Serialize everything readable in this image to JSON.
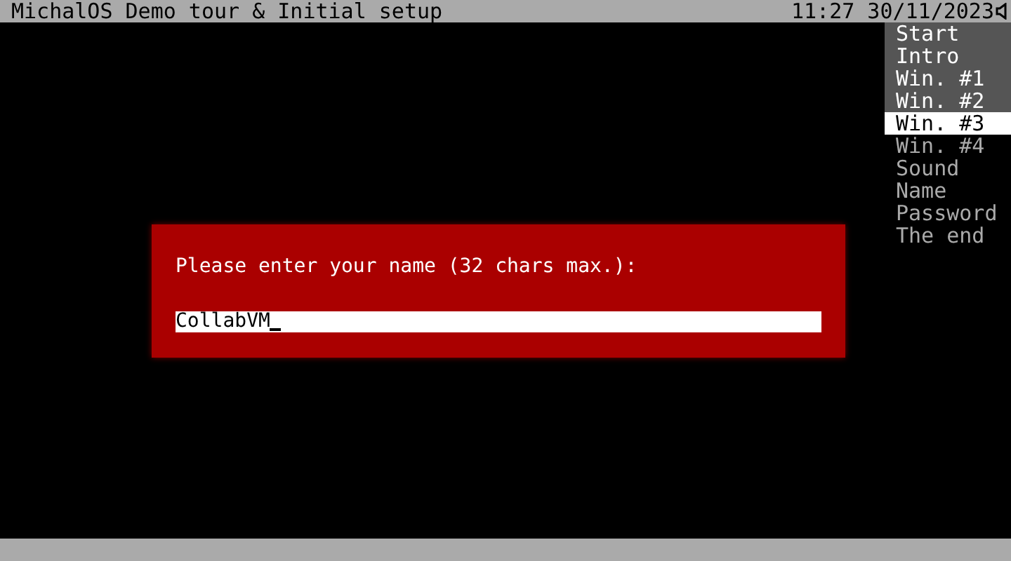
{
  "top_bar": {
    "title": "MichalOS Demo tour & Initial setup",
    "clock": "11:27 30/11/2023"
  },
  "steps": [
    {
      "label": "Start",
      "done": true,
      "selected": false
    },
    {
      "label": "Intro",
      "done": true,
      "selected": false
    },
    {
      "label": "Win. #1",
      "done": true,
      "selected": false
    },
    {
      "label": "Win. #2",
      "done": true,
      "selected": false
    },
    {
      "label": "Win. #3",
      "done": false,
      "selected": true
    },
    {
      "label": "Win. #4",
      "done": false,
      "selected": false
    },
    {
      "label": "Sound",
      "done": false,
      "selected": false
    },
    {
      "label": "Name",
      "done": false,
      "selected": false
    },
    {
      "label": "Password",
      "done": false,
      "selected": false
    },
    {
      "label": "The end",
      "done": false,
      "selected": false
    }
  ],
  "dialog": {
    "prompt": "Please enter your name (32 chars max.):",
    "value": "CollabVM"
  }
}
